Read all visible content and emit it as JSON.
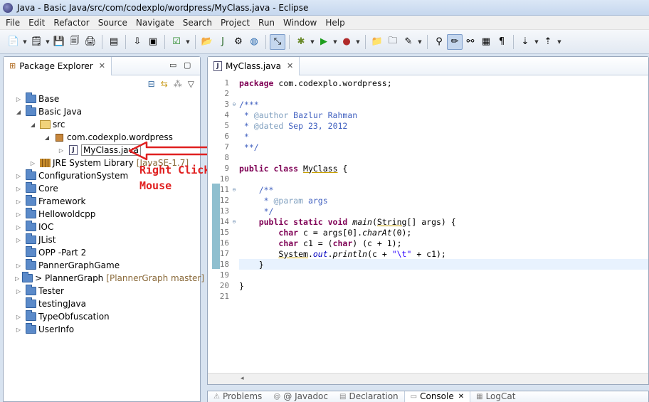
{
  "window": {
    "title": "Java - Basic Java/src/com/codexplo/wordpress/MyClass.java - Eclipse"
  },
  "menu": [
    "File",
    "Edit",
    "Refactor",
    "Source",
    "Navigate",
    "Search",
    "Project",
    "Run",
    "Window",
    "Help"
  ],
  "package_explorer": {
    "tab_label": "Package Explorer",
    "tree": [
      {
        "label": "Base",
        "indent": 0,
        "twisty": "right",
        "icon": "project"
      },
      {
        "label": "Basic Java",
        "indent": 0,
        "twisty": "down",
        "icon": "project"
      },
      {
        "label": "src",
        "indent": 1,
        "twisty": "down",
        "icon": "source-folder"
      },
      {
        "label": "com.codexplo.wordpress",
        "indent": 2,
        "twisty": "down",
        "icon": "package"
      },
      {
        "label": "MyClass.java",
        "indent": 3,
        "twisty": "right",
        "icon": "java-file",
        "selected": true
      },
      {
        "label": "JRE System Library",
        "suffix": "[JavaSE-1.7]",
        "indent": 1,
        "twisty": "right",
        "icon": "library"
      },
      {
        "label": "ConfigurationSystem",
        "indent": 0,
        "twisty": "right",
        "icon": "project"
      },
      {
        "label": "Core",
        "indent": 0,
        "twisty": "right",
        "icon": "project"
      },
      {
        "label": "Framework",
        "indent": 0,
        "twisty": "right",
        "icon": "project"
      },
      {
        "label": "Hellowoldcpp",
        "indent": 0,
        "twisty": "right",
        "icon": "project"
      },
      {
        "label": "IOC",
        "indent": 0,
        "twisty": "right",
        "icon": "project"
      },
      {
        "label": "JList",
        "indent": 0,
        "twisty": "right",
        "icon": "project"
      },
      {
        "label": "OPP -Part 2",
        "indent": 0,
        "twisty": "",
        "icon": "project"
      },
      {
        "label": "PannerGraphGame",
        "indent": 0,
        "twisty": "right",
        "icon": "project"
      },
      {
        "label": "> PlannerGraph",
        "suffix": "[PlannerGraph master]",
        "indent": 0,
        "twisty": "right",
        "icon": "project"
      },
      {
        "label": "Tester",
        "indent": 0,
        "twisty": "right",
        "icon": "project"
      },
      {
        "label": "testingJava",
        "indent": 0,
        "twisty": "",
        "icon": "project"
      },
      {
        "label": "TypeObfuscation",
        "indent": 0,
        "twisty": "right",
        "icon": "project"
      },
      {
        "label": "UserInfo",
        "indent": 0,
        "twisty": "right",
        "icon": "project"
      }
    ]
  },
  "annotation": {
    "line1": "Right Click on",
    "line2": "Mouse",
    "color": "#e02020"
  },
  "editor": {
    "tab_label": "MyClass.java",
    "lines": [
      {
        "n": "1",
        "fold": "",
        "html": "<span class='kw'>package</span> com.codexplo.wordpress;"
      },
      {
        "n": "2",
        "fold": "",
        "html": ""
      },
      {
        "n": "3",
        "fold": "⊖",
        "html": "<span class='cm'>/***</span>"
      },
      {
        "n": "4",
        "fold": "",
        "html": "<span class='cm'> * </span><span class='tag'>@author</span><span class='cm'> Bazlur Rahman</span>"
      },
      {
        "n": "5",
        "fold": "",
        "html": "<span class='cm'> * </span><span class='tag'>@dated</span><span class='cm'> Sep 23, 2012</span>"
      },
      {
        "n": "6",
        "fold": "",
        "html": "<span class='cm'> *</span>"
      },
      {
        "n": "7",
        "fold": "",
        "html": "<span class='cm'> **/</span>"
      },
      {
        "n": "8",
        "fold": "",
        "html": ""
      },
      {
        "n": "9",
        "fold": "",
        "html": "<span class='kw'>public class</span> <span class='cls'>MyClass</span> {"
      },
      {
        "n": "10",
        "fold": "",
        "html": ""
      },
      {
        "n": "11",
        "fold": "⊖",
        "html": "    <span class='cm'>/**</span>"
      },
      {
        "n": "12",
        "fold": "",
        "html": "<span class='cm'>     * </span><span class='tag'>@param</span><span class='cm'> args</span>"
      },
      {
        "n": "13",
        "fold": "",
        "html": "<span class='cm'>     */</span>"
      },
      {
        "n": "14",
        "fold": "⊖",
        "html": "    <span class='kw'>public static void</span> <span class='mth'>main</span>(<span class='cls'>String</span>[] args) {"
      },
      {
        "n": "15",
        "fold": "",
        "html": "        <span class='kw'>char</span> c = args[0].<span class='mth'>charAt</span>(0);"
      },
      {
        "n": "16",
        "fold": "",
        "html": "        <span class='kw'>char</span> c1 = (<span class='kw'>char</span>) (c + 1);"
      },
      {
        "n": "17",
        "fold": "",
        "html": "        <span class='cls'>System</span>.<span class='fld'>out</span>.<span class='mth'>println</span>(c + <span class='str'>\"\\t\"</span> + c1);"
      },
      {
        "n": "18",
        "fold": "",
        "html": "    }"
      },
      {
        "n": "19",
        "fold": "",
        "html": ""
      },
      {
        "n": "20",
        "fold": "",
        "html": "}"
      },
      {
        "n": "21",
        "fold": "",
        "html": ""
      }
    ],
    "highlight_line": "18"
  },
  "bottom_tabs": [
    "Problems",
    "@ Javadoc",
    "Declaration",
    "Console",
    "LogCat"
  ],
  "bottom_active": "Console"
}
